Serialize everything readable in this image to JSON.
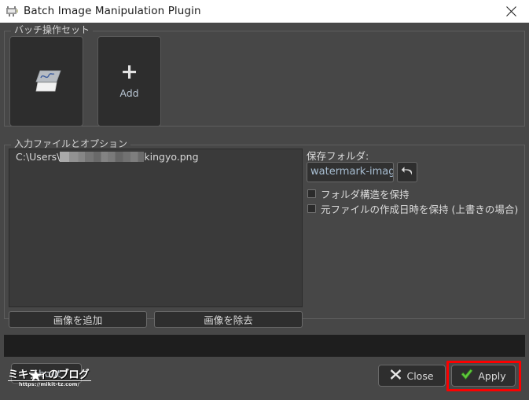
{
  "window": {
    "title": "Batch Image Manipulation Plugin",
    "icon": "plugin-icon",
    "close_icon": "close-icon"
  },
  "batch_group": {
    "title": "バッチ操作セット",
    "tiles": [
      {
        "name": "curves-operation",
        "icon": "layers-curve-icon",
        "label": ""
      },
      {
        "name": "add-operation",
        "icon": "plus-icon",
        "label": "Add"
      }
    ]
  },
  "input_group": {
    "title": "入力ファイルとオプション",
    "files": [
      {
        "prefix": "C:\\Users\\",
        "redacted": true,
        "suffix": "kingyo.png"
      }
    ],
    "buttons": {
      "add_image": "画像を追加",
      "remove_image": "画像を除去"
    }
  },
  "options": {
    "save_folder_label": "保存フォルダ:",
    "save_folder_value": "watermark-image",
    "save_folder_placeholder": "watermark-image",
    "reset_icon": "undo-arrow-icon",
    "checkboxes": [
      {
        "label": "フォルダ構造を保持",
        "checked": false
      },
      {
        "label": "元ファイルの作成日時を保持 (上書きの場合)",
        "checked": false
      }
    ]
  },
  "progress": {
    "value": 0,
    "text": ""
  },
  "footer": {
    "about_label": "About",
    "close_label": "Close",
    "close_icon": "x-mark-icon",
    "apply_label": "Apply",
    "apply_icon": "green-check-icon",
    "highlight_color": "#fc0000"
  },
  "watermark": {
    "text": "ミキティのブログ",
    "url": "https://mikit-tz.com/",
    "star_icon": "star-icon"
  },
  "colors": {
    "window_bg": "#474747",
    "titlebar_bg": "#ffffff",
    "panel_dark": "#2d2d2d",
    "list_bg": "#3a3a3a",
    "progress_bg": "#1e1e1e",
    "accent_link": "#a8bed2",
    "apply_check": "#56c442",
    "highlight": "#fc0000"
  }
}
